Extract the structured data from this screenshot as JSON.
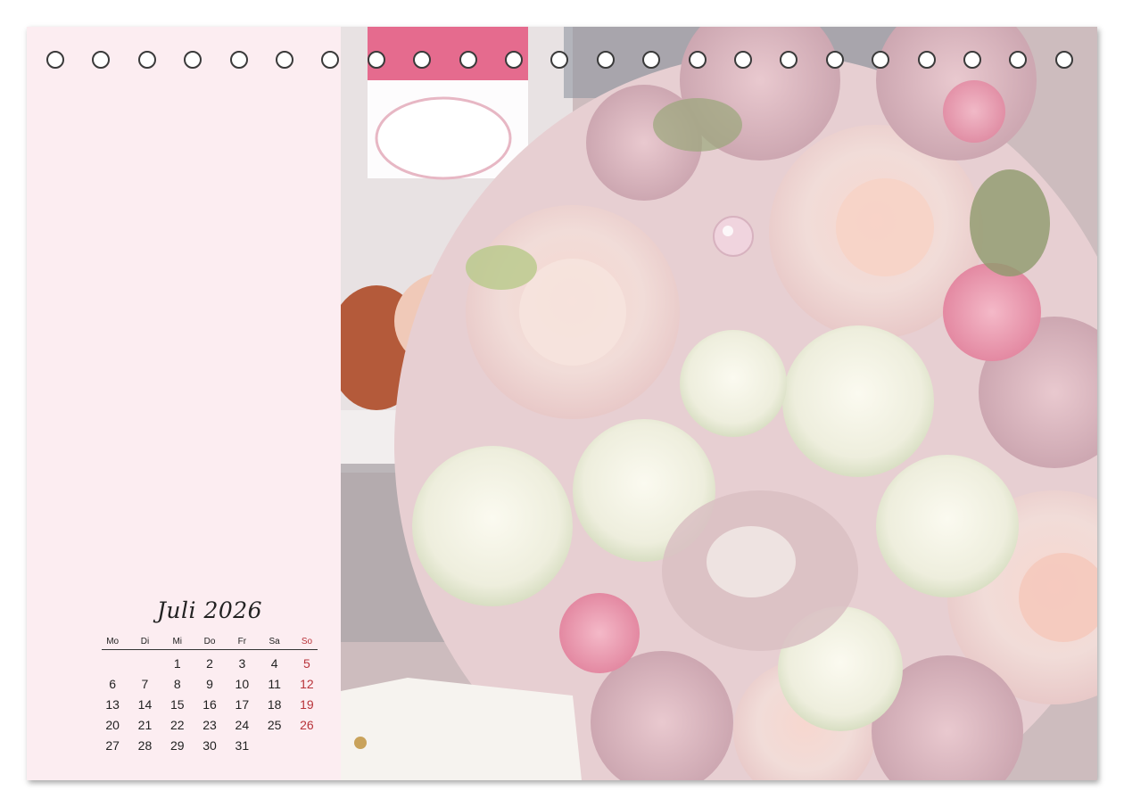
{
  "calendar": {
    "month_title": "Juli 2026",
    "weekdays": [
      "Mo",
      "Di",
      "Mi",
      "Do",
      "Fr",
      "Sa",
      "So"
    ],
    "weeks": [
      [
        "",
        "",
        "1",
        "2",
        "3",
        "4",
        "5"
      ],
      [
        "6",
        "7",
        "8",
        "9",
        "10",
        "11",
        "12"
      ],
      [
        "13",
        "14",
        "15",
        "16",
        "17",
        "18",
        "19"
      ],
      [
        "20",
        "21",
        "22",
        "23",
        "24",
        "25",
        "26"
      ],
      [
        "27",
        "28",
        "29",
        "30",
        "31",
        "",
        ""
      ]
    ]
  },
  "binding": {
    "ring_count": 23
  },
  "colors": {
    "panel_background": "#fcedf1",
    "sunday": "#b8333a",
    "text": "#222222"
  }
}
